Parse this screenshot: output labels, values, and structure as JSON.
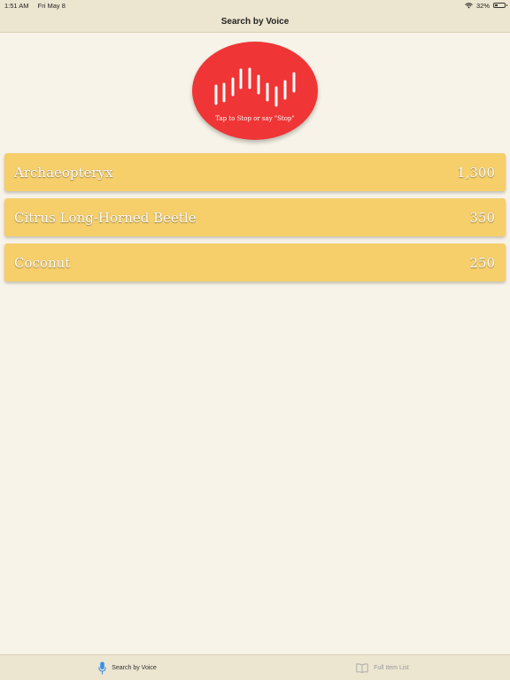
{
  "status_bar": {
    "time": "1:51 AM",
    "date": "Fri May 8",
    "battery": "32%",
    "battery_level": 0.32
  },
  "nav": {
    "title": "Search by Voice"
  },
  "voice_button": {
    "hint": "Tap to Stop or say \"Stop\"",
    "color": "#ef3535",
    "icon": "sound-wave-icon"
  },
  "results": [
    {
      "name": "Archaeopteryx",
      "value": "1,300"
    },
    {
      "name": "Citrus Long-Horned Beetle",
      "value": "350"
    },
    {
      "name": "Coconut",
      "value": "250"
    }
  ],
  "tabs": [
    {
      "label": "Search by Voice",
      "icon": "microphone-icon",
      "active": true,
      "color": "#3a8ee6"
    },
    {
      "label": "Full Item List",
      "icon": "book-icon",
      "active": false
    }
  ],
  "colors": {
    "background": "#f7f3e8",
    "bar": "#ece5cf",
    "row": "#f6cf6b"
  }
}
